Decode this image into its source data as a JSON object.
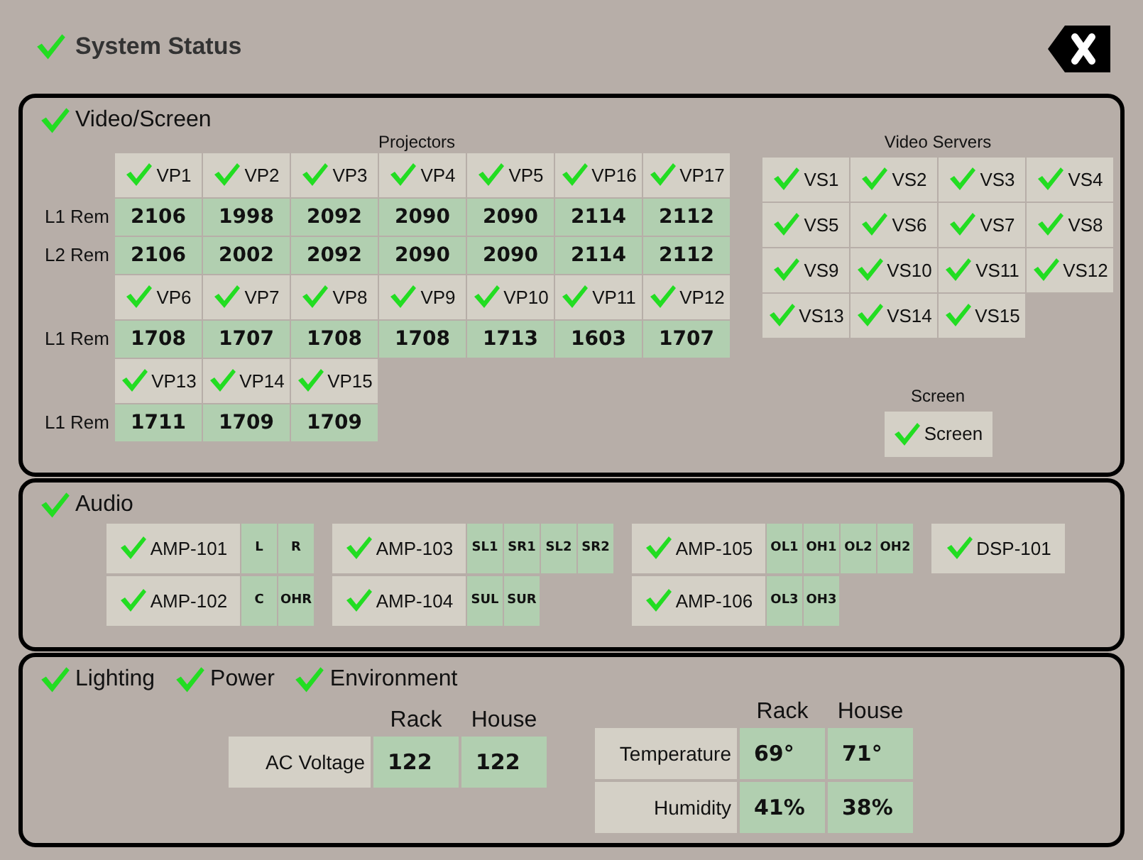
{
  "header": {
    "title": "System Status",
    "ok": true
  },
  "video_screen": {
    "label": "Video/Screen",
    "ok": true,
    "projectors": {
      "title": "Projectors",
      "groups": [
        {
          "devices": [
            {
              "name": "VP1",
              "ok": true
            },
            {
              "name": "VP2",
              "ok": true
            },
            {
              "name": "VP3",
              "ok": true
            },
            {
              "name": "VP4",
              "ok": true
            },
            {
              "name": "VP5",
              "ok": true
            },
            {
              "name": "VP16",
              "ok": true
            },
            {
              "name": "VP17",
              "ok": true
            }
          ],
          "rows": [
            {
              "label": "L1 Rem",
              "values": [
                "2106",
                "1998",
                "2092",
                "2090",
                "2090",
                "2114",
                "2112"
              ]
            },
            {
              "label": "L2 Rem",
              "values": [
                "2106",
                "2002",
                "2092",
                "2090",
                "2090",
                "2114",
                "2112"
              ]
            }
          ]
        },
        {
          "devices": [
            {
              "name": "VP6",
              "ok": true
            },
            {
              "name": "VP7",
              "ok": true
            },
            {
              "name": "VP8",
              "ok": true
            },
            {
              "name": "VP9",
              "ok": true
            },
            {
              "name": "VP10",
              "ok": true
            },
            {
              "name": "VP11",
              "ok": true
            },
            {
              "name": "VP12",
              "ok": true
            }
          ],
          "rows": [
            {
              "label": "L1 Rem",
              "values": [
                "1708",
                "1707",
                "1708",
                "1708",
                "1713",
                "1603",
                "1707"
              ]
            }
          ]
        },
        {
          "devices": [
            {
              "name": "VP13",
              "ok": true
            },
            {
              "name": "VP14",
              "ok": true
            },
            {
              "name": "VP15",
              "ok": true
            }
          ],
          "rows": [
            {
              "label": "L1 Rem",
              "values": [
                "1711",
                "1709",
                "1709"
              ]
            }
          ]
        }
      ]
    },
    "video_servers": {
      "title": "Video Servers",
      "devices": [
        {
          "name": "VS1",
          "ok": true
        },
        {
          "name": "VS2",
          "ok": true
        },
        {
          "name": "VS3",
          "ok": true
        },
        {
          "name": "VS4",
          "ok": true
        },
        {
          "name": "VS5",
          "ok": true
        },
        {
          "name": "VS6",
          "ok": true
        },
        {
          "name": "VS7",
          "ok": true
        },
        {
          "name": "VS8",
          "ok": true
        },
        {
          "name": "VS9",
          "ok": true
        },
        {
          "name": "VS10",
          "ok": true
        },
        {
          "name": "VS11",
          "ok": true
        },
        {
          "name": "VS12",
          "ok": true
        },
        {
          "name": "VS13",
          "ok": true
        },
        {
          "name": "VS14",
          "ok": true
        },
        {
          "name": "VS15",
          "ok": true
        }
      ]
    },
    "screen": {
      "title": "Screen",
      "devices": [
        {
          "name": "Screen",
          "ok": true
        }
      ]
    }
  },
  "audio": {
    "label": "Audio",
    "ok": true,
    "groups": [
      {
        "amps": [
          {
            "name": "AMP-101",
            "ok": true,
            "channels": [
              "L",
              "R"
            ]
          },
          {
            "name": "AMP-102",
            "ok": true,
            "channels": [
              "C",
              "OHR"
            ]
          }
        ]
      },
      {
        "amps": [
          {
            "name": "AMP-103",
            "ok": true,
            "channels": [
              "SL1",
              "SR1",
              "SL2",
              "SR2"
            ]
          },
          {
            "name": "AMP-104",
            "ok": true,
            "channels": [
              "SUL",
              "SUR"
            ]
          }
        ]
      },
      {
        "amps": [
          {
            "name": "AMP-105",
            "ok": true,
            "channels": [
              "OL1",
              "OH1",
              "OL2",
              "OH2"
            ]
          },
          {
            "name": "AMP-106",
            "ok": true,
            "channels": [
              "OL3",
              "OH3"
            ]
          }
        ]
      },
      {
        "amps": [
          {
            "name": "DSP-101",
            "ok": true
          }
        ]
      }
    ]
  },
  "facilities": {
    "indicators": [
      {
        "label": "Lighting",
        "ok": true
      },
      {
        "label": "Power",
        "ok": true
      },
      {
        "label": "Environment",
        "ok": true
      }
    ],
    "tables": [
      {
        "columns": [
          "Rack",
          "House"
        ],
        "rows": [
          {
            "label": "AC Voltage",
            "values": [
              "122",
              "122"
            ]
          }
        ]
      },
      {
        "columns": [
          "Rack",
          "House"
        ],
        "rows": [
          {
            "label": "Temperature",
            "values": [
              "69°",
              "71°"
            ]
          },
          {
            "label": "Humidity",
            "values": [
              "41%",
              "38%"
            ]
          }
        ]
      }
    ]
  }
}
